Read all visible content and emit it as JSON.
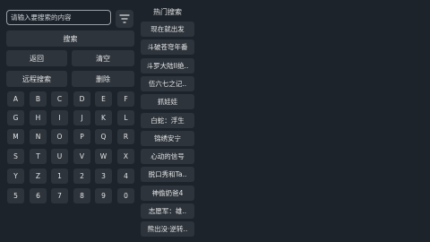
{
  "search": {
    "placeholder": "请输入要搜索的内容"
  },
  "actions": {
    "search_label": "搜索",
    "back_label": "返回",
    "clear_label": "清空",
    "remote_search_label": "远程搜索",
    "delete_label": "删除"
  },
  "keyboard": {
    "rows": [
      [
        "A",
        "B",
        "C",
        "D",
        "E",
        "F"
      ],
      [
        "G",
        "H",
        "I",
        "J",
        "K",
        "L"
      ],
      [
        "M",
        "N",
        "O",
        "P",
        "Q",
        "R"
      ],
      [
        "S",
        "T",
        "U",
        "V",
        "W",
        "X"
      ],
      [
        "Y",
        "Z",
        "1",
        "2",
        "3",
        "4"
      ],
      [
        "5",
        "6",
        "7",
        "8",
        "9",
        "0"
      ]
    ]
  },
  "hot": {
    "title": "热门搜索",
    "items": [
      "现在就出发",
      "斗破苍穹年番",
      "斗罗大陆II绝..",
      "伍六七之记..",
      "抓娃娃",
      "白蛇：浮生",
      "锦绣安宁",
      "心动的信号",
      "脱口秀和Ta..",
      "神偷奶爸4",
      "志愿军：雄..",
      "熊出没·逆转.."
    ]
  },
  "icons": {
    "filter": "filter-icon"
  }
}
